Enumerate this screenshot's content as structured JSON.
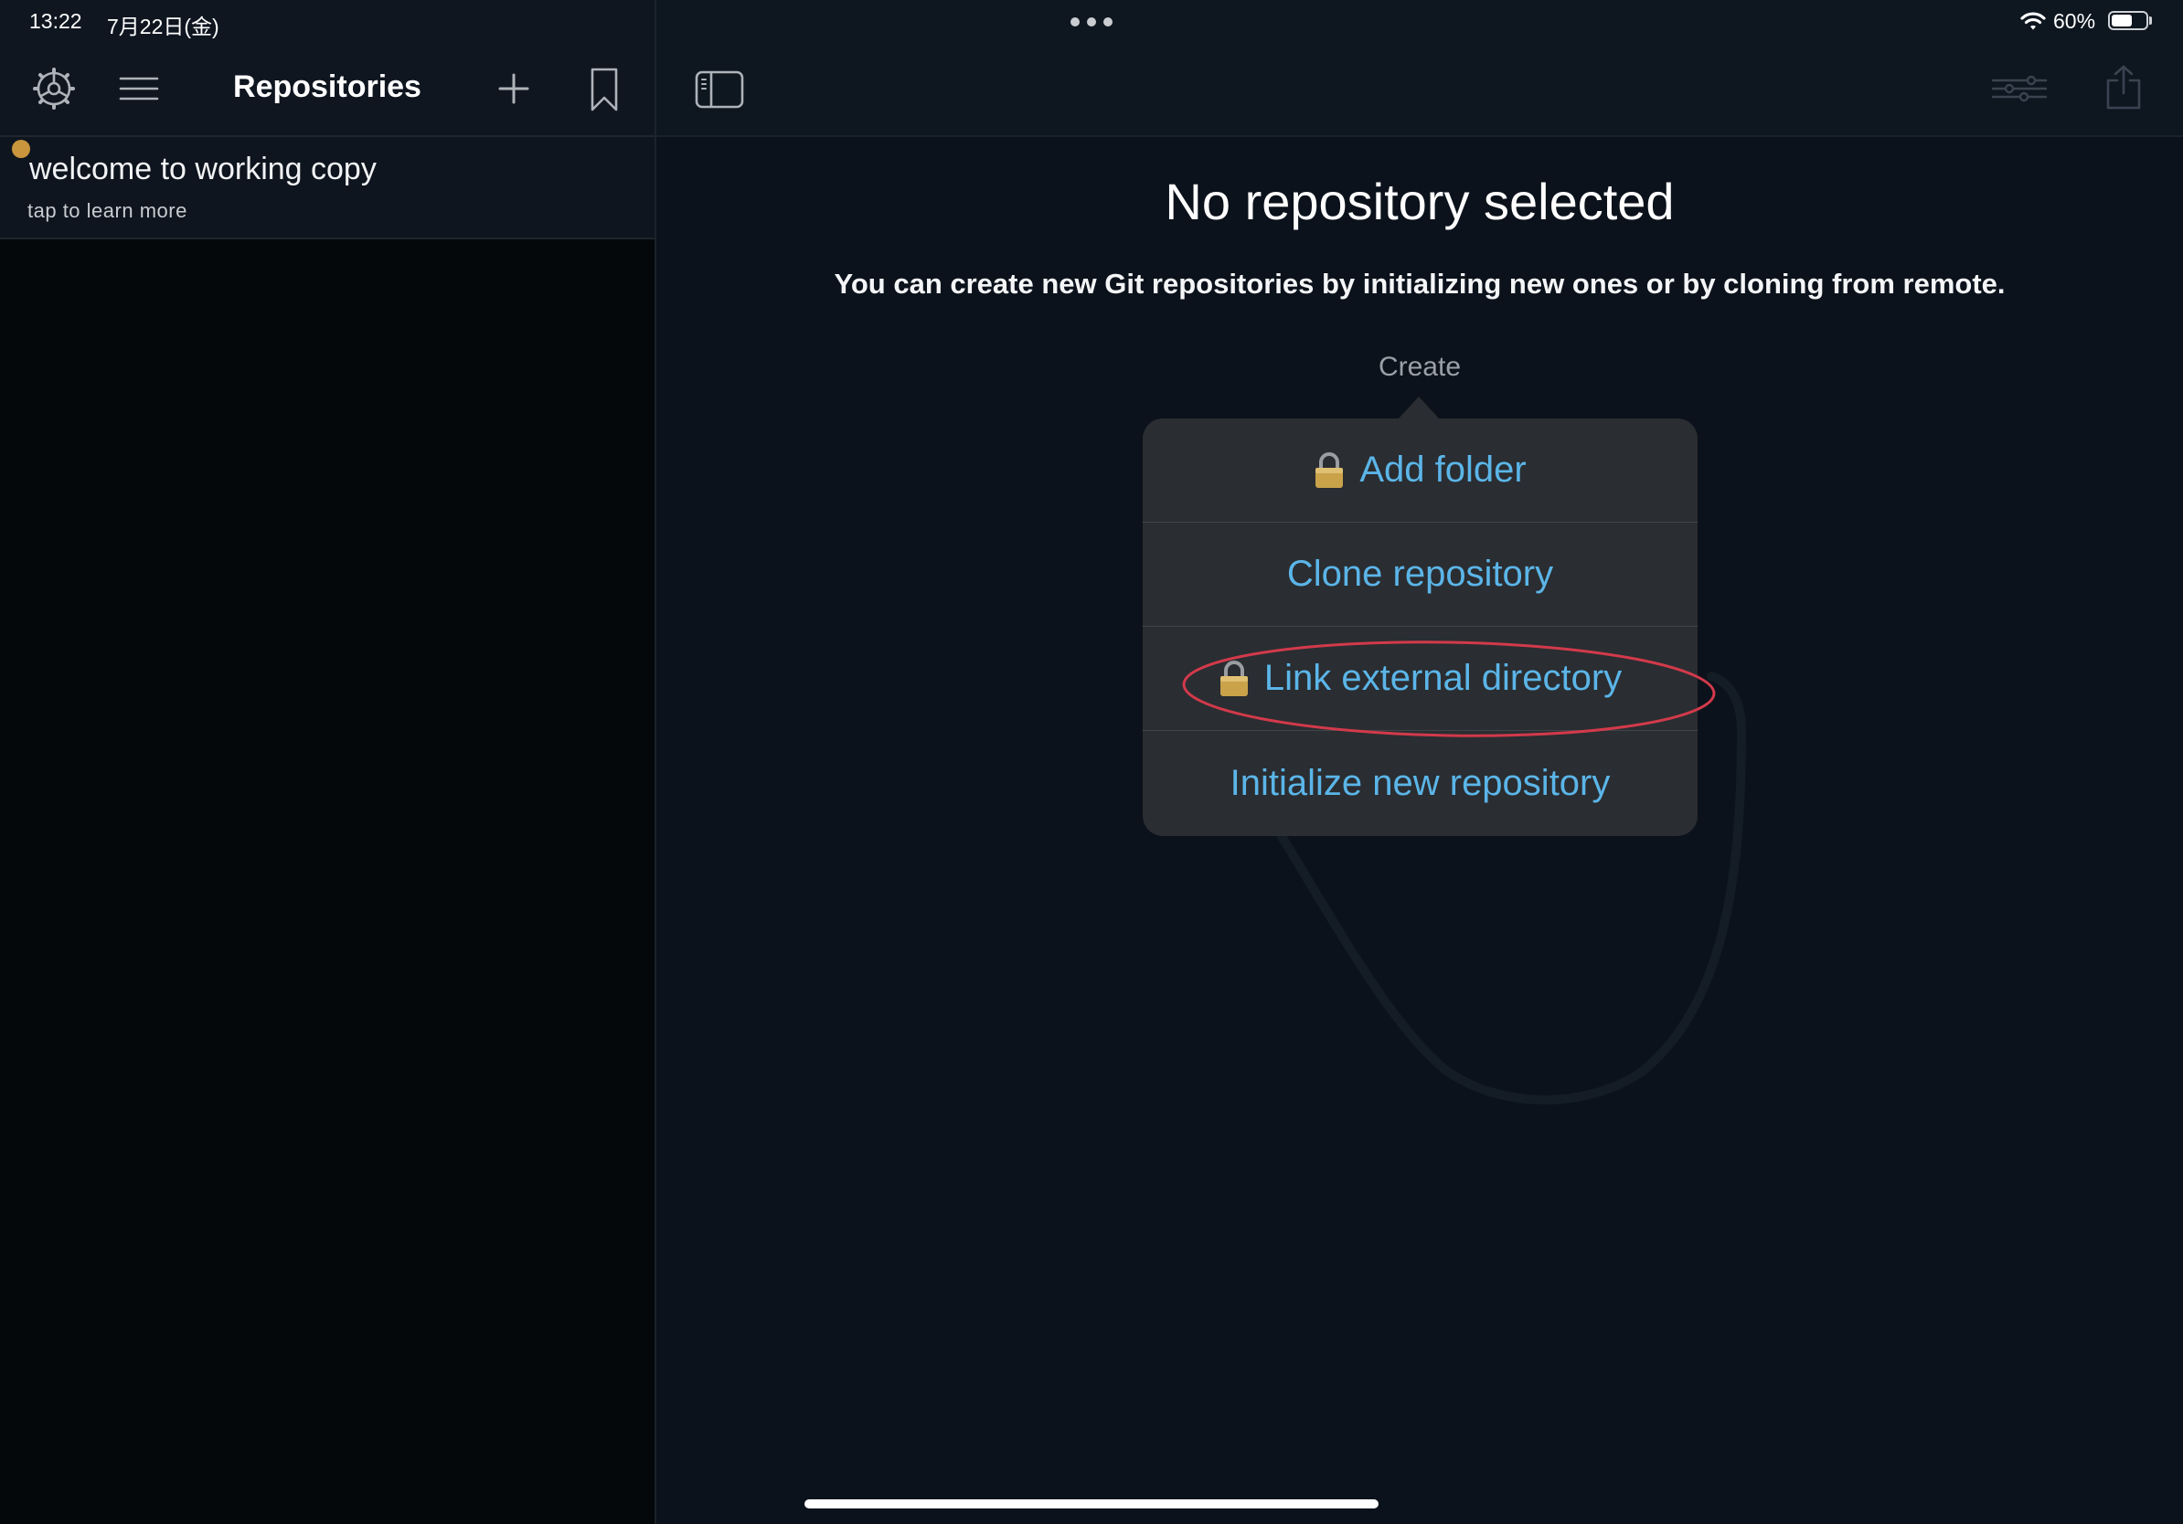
{
  "status_bar": {
    "time": "13:22",
    "date": "7月22日(金)",
    "battery_label": "60%",
    "battery_level": 0.6,
    "icons": [
      "multitasking-dots-icon",
      "wifi-icon",
      "battery-icon"
    ]
  },
  "sidebar": {
    "title": "Repositories",
    "toolbar_icons": [
      "settings-gear-icon",
      "menu-icon",
      "add-icon",
      "bookmark-icon"
    ],
    "items": [
      {
        "title": "welcome to working copy",
        "subtitle": "tap to learn more",
        "status_dot_color": "#c9953d"
      }
    ]
  },
  "main": {
    "toolbar_icons": [
      "sidebar-toggle-icon",
      "filter-sliders-icon",
      "share-icon"
    ],
    "heading": "No repository selected",
    "description": "You can create new Git repositories by initializing new ones or by cloning from remote.",
    "create_label": "Create",
    "menu": [
      {
        "label": "Add folder",
        "locked": true
      },
      {
        "label": "Clone repository",
        "locked": false
      },
      {
        "label": "Link external directory",
        "locked": true,
        "highlighted": true
      },
      {
        "label": "Initialize new repository",
        "locked": false
      }
    ]
  },
  "colors": {
    "background": "#0b121b",
    "sidebar_background": "#04080b",
    "popover_background": "#2a2d31",
    "accent": "#5bb5e8",
    "highlight_ring": "#d23a4b",
    "lock_gold": "#c9a24a",
    "disabled_icon": "#3a4450"
  }
}
